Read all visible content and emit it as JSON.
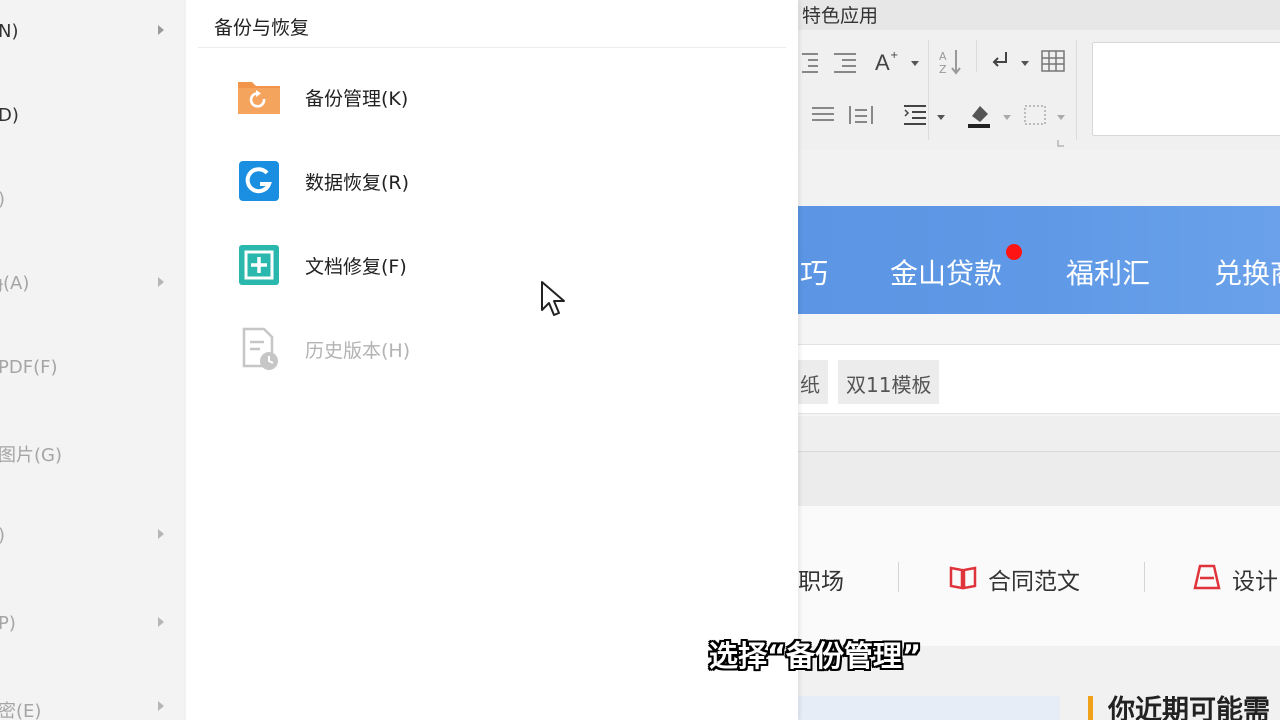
{
  "left_menu": {
    "items": [
      {
        "label": "N)",
        "dim": false,
        "has_arrow": true
      },
      {
        "label": "D)",
        "dim": false,
        "has_arrow": false
      },
      {
        "label": ")",
        "dim": true,
        "has_arrow": false
      },
      {
        "label": "ɟ(A)",
        "dim": true,
        "has_arrow": true
      },
      {
        "label": "PDF(F)",
        "dim": true,
        "has_arrow": false
      },
      {
        "label": "图片(G)",
        "dim": true,
        "has_arrow": false
      },
      {
        "label": ")",
        "dim": true,
        "has_arrow": true
      },
      {
        "label": "P)",
        "dim": true,
        "has_arrow": true
      },
      {
        "label": "密(E)",
        "dim": true,
        "has_arrow": true
      }
    ]
  },
  "submenu": {
    "title": "备份与恢复",
    "items": [
      {
        "label": "备份管理(K)",
        "icon": "backup-folder-icon",
        "enabled": true
      },
      {
        "label": "数据恢复(R)",
        "icon": "data-recovery-icon",
        "enabled": true
      },
      {
        "label": "文档修复(F)",
        "icon": "document-repair-icon",
        "enabled": true
      },
      {
        "label": "历史版本(H)",
        "icon": "history-version-icon",
        "enabled": false
      }
    ]
  },
  "caption": "选择“备份管理”",
  "app": {
    "ribbon_tab": "特色应用",
    "banner_items": [
      "巧",
      "金山贷款",
      "福利汇",
      "兑换商"
    ],
    "tags": [
      "纸",
      "双11模板"
    ],
    "categories": [
      "职场",
      "合同范文",
      "设计"
    ],
    "section_title": "你近期可能需"
  },
  "colors": {
    "banner": "#5f99e6",
    "badge": "#ff1414",
    "icon_orange": "#f0954a",
    "icon_blue": "#1a8ee0",
    "icon_teal": "#2ab7ae",
    "accent_red": "#e0343b",
    "accent_yellow": "#f0a21b"
  }
}
